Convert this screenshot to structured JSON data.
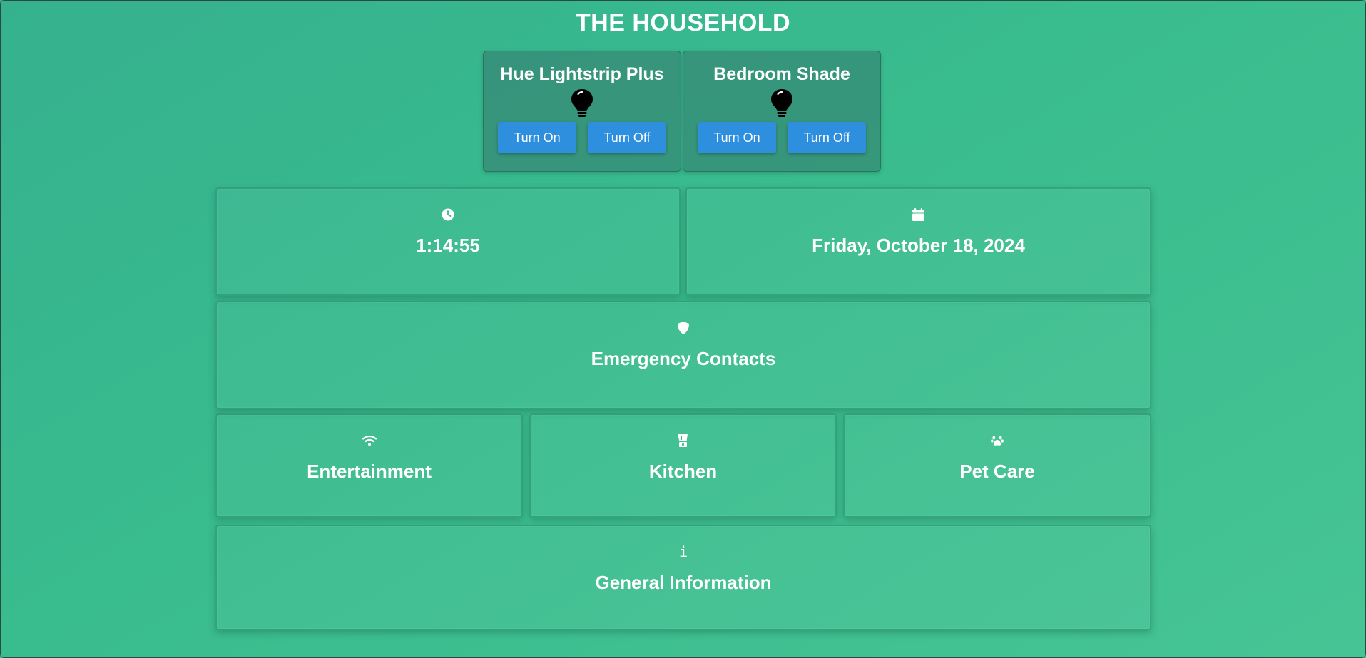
{
  "header": {
    "title": "THE HOUSEHOLD"
  },
  "devices": [
    {
      "name": "Hue Lightstrip Plus",
      "icon": "lightbulb-icon",
      "on_label": "Turn On",
      "off_label": "Turn Off"
    },
    {
      "name": "Bedroom Shade",
      "icon": "lightbulb-icon",
      "on_label": "Turn On",
      "off_label": "Turn Off"
    }
  ],
  "tiles": {
    "clock": {
      "icon": "clock-icon",
      "label": "1:14:55"
    },
    "date": {
      "icon": "calendar-icon",
      "label": "Friday, October 18, 2024"
    },
    "emergency": {
      "icon": "shield-icon",
      "label": "Emergency Contacts"
    },
    "entertainment": {
      "icon": "wifi-icon",
      "label": "Entertainment"
    },
    "kitchen": {
      "icon": "blender-icon",
      "label": "Kitchen"
    },
    "pet_care": {
      "icon": "paw-icon",
      "label": "Pet Care"
    },
    "general": {
      "icon": "info-icon",
      "glyph": "i",
      "label": "General Information"
    }
  },
  "colors": {
    "background_start": "#35b18e",
    "background_end": "#46c495",
    "button": "#2f8fdf",
    "text": "#ffffff"
  }
}
